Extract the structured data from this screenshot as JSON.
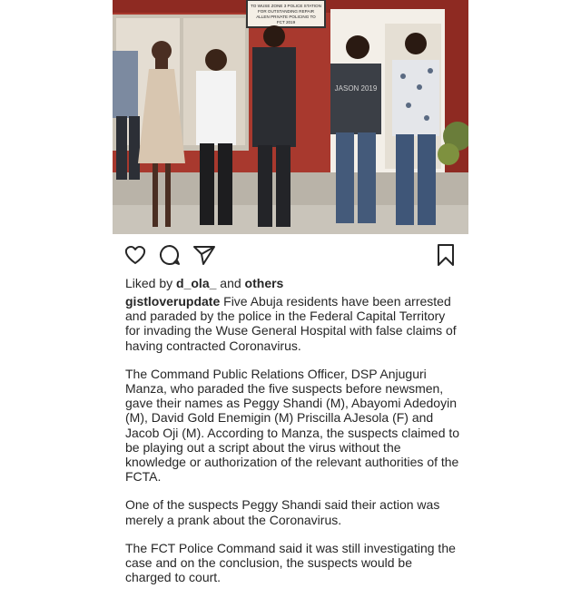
{
  "post": {
    "photo": {
      "description_icon": "photo-of-five-suspects",
      "sign_lines": [
        "TO WUSE ZONE 3 POLICE STATION",
        "FOR OUTSTANDING REPAIR",
        "ALLEN PRIVATE POLICING TO",
        "FCT 2019"
      ],
      "shirt_text": "JASON 2019"
    },
    "actions": {
      "like_icon": "heart-icon",
      "comment_icon": "comment-icon",
      "share_icon": "paper-plane-icon",
      "save_icon": "bookmark-icon"
    },
    "likes": {
      "prefix": "Liked by",
      "user": "d_ola_",
      "joiner": "and",
      "others": "others"
    },
    "caption": {
      "username": "gistloverupdate",
      "paragraphs": [
        "Five Abuja residents have been arrested and paraded by the police in the Federal Capital Territory for invading the Wuse General Hospital with false claims of having contracted Coronavirus.",
        "The Command Public Relations Officer, DSP Anjuguri Manza, who paraded the five suspects before newsmen, gave their names as Peggy Shandi (M), Abayomi Adedoyin (M), David Gold Enemigin (M) Priscilla AJesola (F) and Jacob Oji (M). According to Manza, the suspects claimed to be playing out a script about the virus without the knowledge or authorization of the relevant authorities of the FCTA.",
        "One of the suspects Peggy Shandi said their action was merely a prank about the Coronavirus.",
        "The FCT Police Command said it was still investigating the case and on the conclusion, the suspects would be charged to court."
      ]
    }
  }
}
